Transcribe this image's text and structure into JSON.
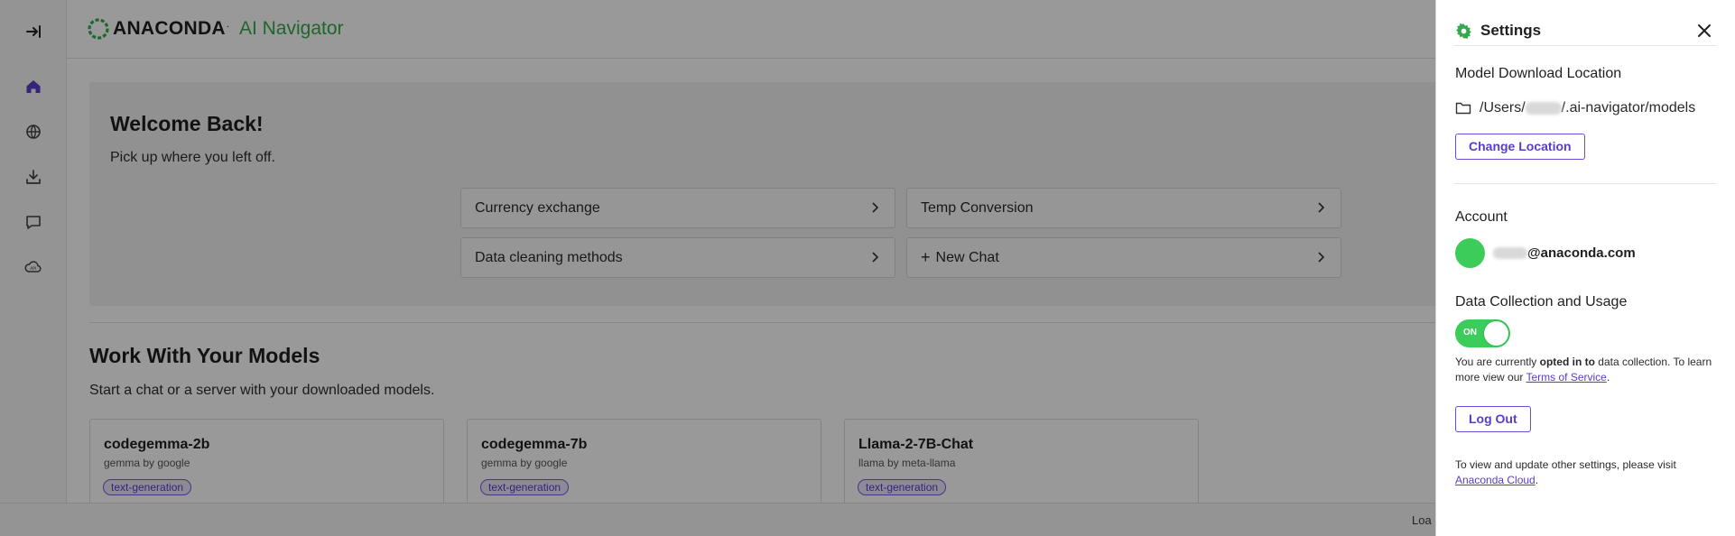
{
  "header": {
    "brand": "ANACONDA",
    "product": "AI Navigator"
  },
  "rail": {
    "items": [
      {
        "icon": "expand-sidebar-icon",
        "label": "Expand"
      },
      {
        "icon": "home-icon",
        "label": "Home"
      },
      {
        "icon": "models-icon",
        "label": "Models"
      },
      {
        "icon": "download-icon",
        "label": "Downloads"
      },
      {
        "icon": "chat-icon",
        "label": "Chat"
      },
      {
        "icon": "api-server-icon",
        "label": "API Server"
      }
    ]
  },
  "welcome": {
    "title": "Welcome Back!",
    "subtitle": "Pick up where you left off.",
    "prompts": [
      {
        "label": "Currency exchange"
      },
      {
        "label": "Temp Conversion"
      },
      {
        "label": "Data cleaning methods"
      },
      {
        "label": "New Chat",
        "icon": "plus"
      }
    ]
  },
  "models": {
    "title": "Work With Your Models",
    "subtitle": "Start a chat or a server with your downloaded models.",
    "cards": [
      {
        "name": "codegemma-2b",
        "by": "gemma by google",
        "tag": "text-generation"
      },
      {
        "name": "codegemma-7b",
        "by": "gemma by google",
        "tag": "text-generation"
      },
      {
        "name": "Llama-2-7B-Chat",
        "by": "llama by meta-llama",
        "tag": "text-generation"
      }
    ]
  },
  "statusbar": {
    "text": "Loa"
  },
  "settings": {
    "title": "Settings",
    "download_location": {
      "title": "Model Download Location",
      "path_prefix": "/Users/",
      "path_suffix": "/.ai-navigator/models",
      "button": "Change Location"
    },
    "account": {
      "title": "Account",
      "email_domain": "@anaconda.com"
    },
    "data_collection": {
      "title": "Data Collection and Usage",
      "toggle_label": "ON",
      "toggle_on": true,
      "text_1": "You are currently ",
      "text_bold": "opted in to",
      "text_2": " data collection. To learn more view our ",
      "link": "Terms of Service",
      "text_end": "."
    },
    "logout_button": "Log Out",
    "footer": {
      "text": "To view and update other settings, please visit ",
      "link": "Anaconda Cloud",
      "text_end": "."
    }
  },
  "colors": {
    "accent_purple": "#5a3cc8",
    "brand_green": "#35a84b",
    "toggle_green": "#3bcc5a",
    "overlay": "rgba(0,0,0,0.4)"
  }
}
